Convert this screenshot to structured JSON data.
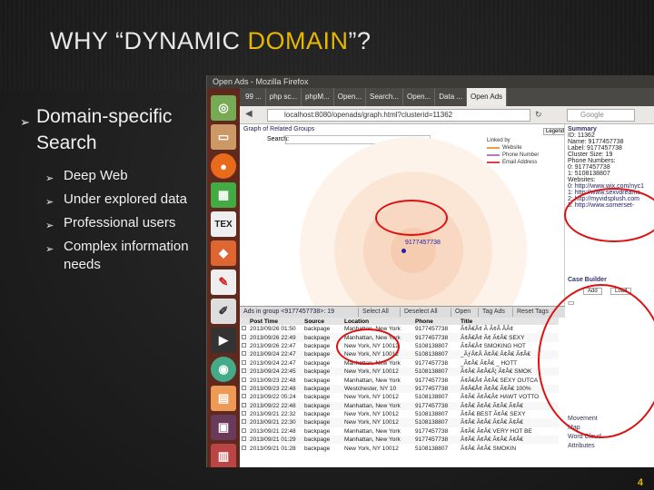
{
  "slide": {
    "title_before": "WHY “DYNAMIC ",
    "title_highlight": "DOMAIN",
    "title_after": "”?",
    "page_number": "4",
    "bullets": {
      "main": "Domain-specific Search",
      "subs": [
        "Deep Web",
        "Under explored data",
        "Professional users",
        "Complex information needs"
      ]
    }
  },
  "browser": {
    "window_title": "Open Ads - Mozilla Firefox",
    "tabs": [
      "99 ...",
      "php sc...",
      "phpM...",
      "Open...",
      "Search...",
      "Open...",
      "Data ...",
      "Open Ads"
    ],
    "url": "localhost:8080/openads/graph.html?clusterid=11362",
    "search_placeholder": "Google"
  },
  "graph": {
    "title": "Graph of Related Groups",
    "search_label": "Search:",
    "node_label": "9177457738",
    "legend": [
      {
        "label": "Linked by",
        "color": "#ffffff"
      },
      {
        "label": "Website",
        "color": "#e6a23c"
      },
      {
        "label": "Phone Number",
        "color": "#b07bc0"
      },
      {
        "label": "Email Address",
        "color": "#e04040"
      }
    ],
    "legend_button": "Legend"
  },
  "summary": {
    "title": "Summary",
    "lines": [
      "ID: 11362",
      "Name: 9177457738",
      "Label: 9177457738",
      "Cluster Size: 19",
      "Phone Numbers:",
      "0: 9177457738",
      "1: 5108138807",
      "Websites:",
      "0: http://www.wix.com/nyc1",
      "1: http://www.sexvdreams",
      "2: http://myvidsplush.com",
      "3: http://www.somerset-"
    ],
    "case_builder": "Case Builder",
    "case_btn1": "Add",
    "case_btn2": "Load"
  },
  "ads": {
    "header": "Ads in group <9177457738>: 19",
    "buttons": [
      "Select All",
      "Deselect All",
      "Open",
      "Tag Ads",
      "Reset Tags"
    ],
    "columns": [
      "",
      "Post Time",
      "Source",
      "Location",
      "Phone",
      "Title"
    ],
    "rows": [
      [
        "2013/09/26 01:50",
        "backpage",
        "Manhattan, New York",
        "9177457738",
        "Ã¢Â€Â¢ Ã Ã¢Â ÂÂ¢"
      ],
      [
        "2013/09/26 22:49",
        "backpage",
        "Manhattan, New York",
        "9177457738",
        "Ã¢Â€Â¢ Ã¢ Ã¢Â€ SEXY"
      ],
      [
        "2013/09/26 22:47",
        "backpage",
        "New York, NY 10012",
        "5108138807",
        "Ã¢Â€Â¢ SMOKING HOT"
      ],
      [
        "2013/09/24 22:47",
        "backpage",
        "New York, NY 10012",
        "5108138807",
        "_ÃƒÂ¢Â Ã¢Â€ Ã¢Â€ Ã¢Â€"
      ],
      [
        "2013/09/24 22:47",
        "backpage",
        "Manhattan, New York",
        "9177457738",
        "_Ã¢Â€ Ã¢Â€ _ HOTT"
      ],
      [
        "2013/09/24 22:45",
        "backpage",
        "New York, NY 10012",
        "5108138807",
        "Ã¢Â€ Ã¢Â€Â¦ Ã¢Â€ SMOK"
      ],
      [
        "2013/09/23 22:48",
        "backpage",
        "Manhattan, New York",
        "9177457738",
        "Ã¢Â€Â¢ Ã¢Â€ SEXY OUTCA"
      ],
      [
        "2013/09/23 22:48",
        "backpage",
        "Westchester, NY 10",
        "9177457738",
        "Ã¢Â€Â¢ Ã¢Â€ Ã¢Â€ 100%"
      ],
      [
        "2013/09/22 05:24",
        "backpage",
        "New York, NY 10012",
        "5108138807",
        "Ã¢Â€ Ã¢Â€Â¢ HAWT VOTTO"
      ],
      [
        "2013/09/22 22:48",
        "backpage",
        "Manhattan, New York",
        "9177457738",
        "Ã¢Â€ Ã¢Â€ Ã¢Â€ Ã¢Â€"
      ],
      [
        "2013/09/21 22:32",
        "backpage",
        "New York, NY 10012",
        "5108138807",
        "Ã¢Â€ BEST Ã¢Â€ SEXY"
      ],
      [
        "2013/09/21 22:30",
        "backpage",
        "New York, NY 10012",
        "5108138807",
        "Ã¢Â€ Ã¢Â€ Ã¢Â€ Ã¢Â€"
      ],
      [
        "2013/09/21 22:48",
        "backpage",
        "Manhattan, New York",
        "9177457738",
        "Ã¢Â€ Ã¢Â€ VERY HOT BE"
      ],
      [
        "2013/09/21 01:29",
        "backpage",
        "Manhattan, New York",
        "9177457738",
        "Ã¢Â€ Ã¢Â€ Ã¢Â€ Ã¢Â€"
      ],
      [
        "2013/09/21 01:28",
        "backpage",
        "New York, NY 10012",
        "5108138807",
        "Ã¢Â€ Ã¢Â€ SMOKIN"
      ]
    ]
  },
  "sidebar_low": {
    "items": [
      "Movement",
      "Map",
      "Word Cloud",
      "Attributes"
    ]
  }
}
